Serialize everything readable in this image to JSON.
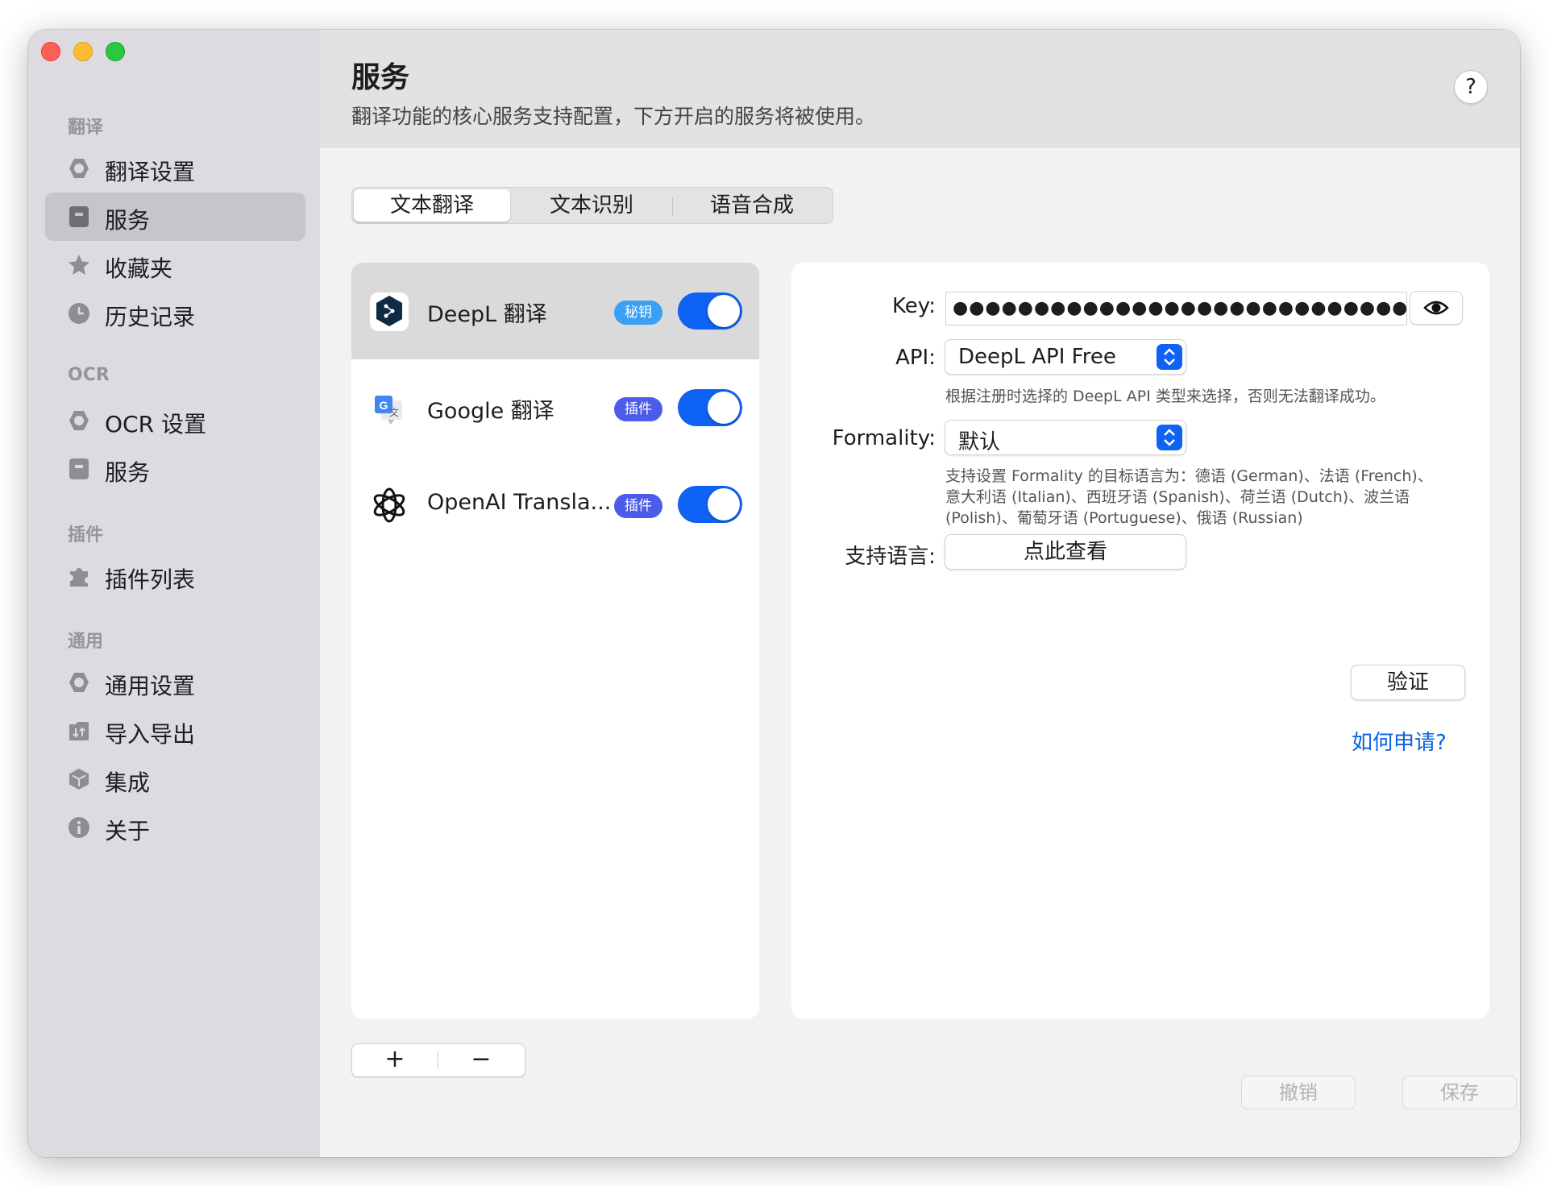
{
  "sidebar": {
    "sections": [
      {
        "title": "翻译",
        "items": [
          {
            "label": "翻译设置",
            "icon": "gear-icon"
          },
          {
            "label": "服务",
            "icon": "bookmark-icon"
          },
          {
            "label": "收藏夹",
            "icon": "star-icon"
          },
          {
            "label": "历史记录",
            "icon": "clock-icon"
          }
        ]
      },
      {
        "title": "OCR",
        "items": [
          {
            "label": "OCR 设置",
            "icon": "gear-icon"
          },
          {
            "label": "服务",
            "icon": "bookmark-icon"
          }
        ]
      },
      {
        "title": "插件",
        "items": [
          {
            "label": "插件列表",
            "icon": "puzzle-icon"
          }
        ]
      },
      {
        "title": "通用",
        "items": [
          {
            "label": "通用设置",
            "icon": "gear-icon"
          },
          {
            "label": "导入导出",
            "icon": "import-export-icon"
          },
          {
            "label": "集成",
            "icon": "cube-icon"
          },
          {
            "label": "关于",
            "icon": "info-icon"
          }
        ]
      }
    ],
    "active_item": "服务"
  },
  "header": {
    "title": "服务",
    "subtitle": "翻译功能的核心服务支持配置，下方开启的服务将被使用。",
    "help_label": "?"
  },
  "tabs": [
    {
      "label": "文本翻译",
      "active": true
    },
    {
      "label": "文本识别",
      "active": false
    },
    {
      "label": "语音合成",
      "active": false
    }
  ],
  "services": [
    {
      "name": "DeepL 翻译",
      "badge": "秘钥",
      "badge_color": "#3aa0f5",
      "enabled": true,
      "selected": true,
      "icon": "deepl-icon"
    },
    {
      "name": "Google 翻译",
      "badge": "插件",
      "badge_color": "#4d5bea",
      "enabled": true,
      "selected": false,
      "icon": "google-translate-icon"
    },
    {
      "name": "OpenAI Transla...",
      "badge": "插件",
      "badge_color": "#4d5bea",
      "enabled": true,
      "selected": false,
      "icon": "openai-icon"
    }
  ],
  "list_controls": {
    "add": "+",
    "remove": "−"
  },
  "detail": {
    "key_label": "Key:",
    "key_value": "●●●●●●●●●●●●●●●●●●●●●●●●●●●●●●●●●●●●●",
    "api_label": "API:",
    "api_value": "DeepL API Free",
    "api_hint": "根据注册时选择的 DeepL API 类型来选择，否则无法翻译成功。",
    "formality_label": "Formality:",
    "formality_value": "默认",
    "formality_hint": "支持设置 Formality 的目标语言为：德语 (German)、法语 (French)、意大利语 (Italian)、西班牙语 (Spanish)、荷兰语 (Dutch)、波兰语 (Polish)、葡萄牙语 (Portuguese)、俄语 (Russian)",
    "languages_label": "支持语言:",
    "languages_button": "点此查看",
    "verify_button": "验证",
    "apply_link": "如何申请?"
  },
  "footer": {
    "cancel": "撤销",
    "save": "保存"
  },
  "colors": {
    "accent": "#0e62f4",
    "link": "#0a62e0",
    "sidebar_bg": "#dddbe0",
    "active_item_bg": "#c6c5cb"
  }
}
